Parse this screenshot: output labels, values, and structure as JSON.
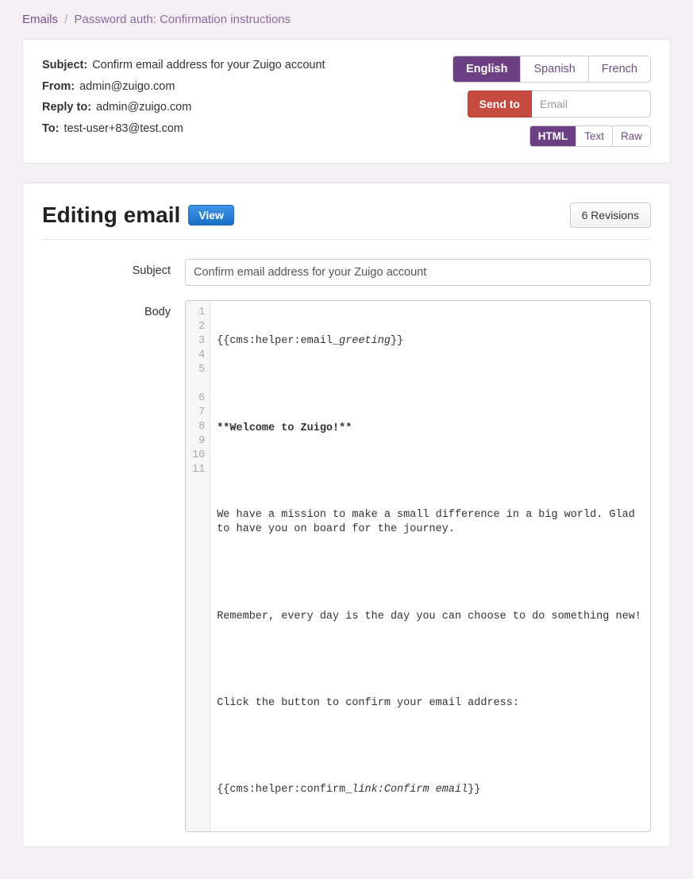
{
  "breadcrumb": {
    "root": "Emails",
    "current": "Password auth: Confirmation instructions"
  },
  "meta": {
    "subject_label": "Subject:",
    "subject_value": "Confirm email address for your Zuigo account",
    "from_label": "From:",
    "from_value": "admin@zuigo.com",
    "reply_label": "Reply to:",
    "reply_value": "admin@zuigo.com",
    "to_label": "To:",
    "to_value": "test-user+83@test.com"
  },
  "lang_tabs": {
    "en": "English",
    "es": "Spanish",
    "fr": "French"
  },
  "sendto": {
    "btn": "Send to",
    "placeholder": "Email"
  },
  "format_tabs": {
    "html": "HTML",
    "text": "Text",
    "raw": "Raw"
  },
  "editor": {
    "title": "Editing email",
    "view_btn": "View",
    "revisions_btn": "6 Revisions",
    "subject_label": "Subject",
    "subject_value": "Confirm email address for your Zuigo account",
    "body_label": "Body",
    "lines": {
      "l1a": "{{cms:helper:email_",
      "l1b": "greeting",
      "l1c": "}}",
      "l3": "**Welcome to Zuigo!**",
      "l5": "We have a mission to make a small difference in a big world. Glad to have you on board for the journey.",
      "l7": "Remember, every day is the day you can choose to do something new!",
      "l9": "Click the button to confirm your email address:",
      "l11a": "{{cms:helper:confirm_",
      "l11b": "link:Confirm email",
      "l11c": "}}"
    },
    "nums": {
      "n1": "1",
      "n2": "2",
      "n3": "3",
      "n4": "4",
      "n5": "5",
      "n6": "6",
      "n7": "7",
      "n8": "8",
      "n9": "9",
      "n10": "10",
      "n11": "11"
    }
  }
}
